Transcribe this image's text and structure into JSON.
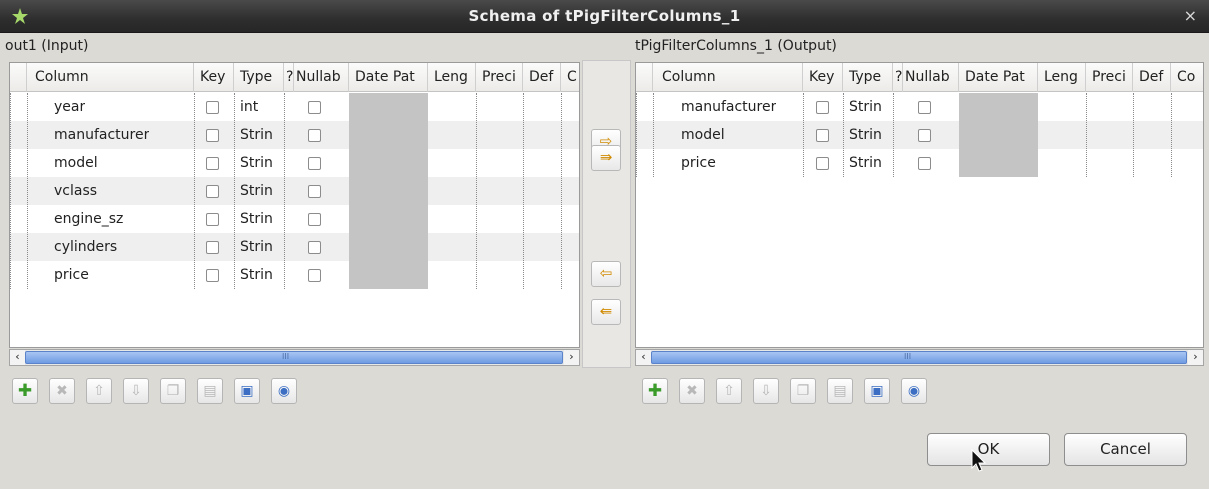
{
  "window": {
    "title": "Schema of tPigFilterColumns_1"
  },
  "left_panel": {
    "title": "out1 (Input)",
    "headers": [
      "Column",
      "Key",
      "Type",
      "?",
      "Nullab",
      "Date Pat",
      "Leng",
      "Preci",
      "Def",
      "C"
    ],
    "rows": [
      {
        "column": "year",
        "type": "int"
      },
      {
        "column": "manufacturer",
        "type": "Strin"
      },
      {
        "column": "model",
        "type": "Strin"
      },
      {
        "column": "vclass",
        "type": "Strin"
      },
      {
        "column": "engine_sz",
        "type": "Strin"
      },
      {
        "column": "cylinders",
        "type": "Strin"
      },
      {
        "column": "price",
        "type": "Strin"
      }
    ],
    "scroll_grip": "III"
  },
  "right_panel": {
    "title": "tPigFilterColumns_1 (Output)",
    "headers": [
      "Column",
      "Key",
      "Type",
      "?",
      "Nullab",
      "Date Pat",
      "Leng",
      "Preci",
      "Def",
      "Co"
    ],
    "rows": [
      {
        "column": "manufacturer",
        "type": "Strin"
      },
      {
        "column": "model",
        "type": "Strin"
      },
      {
        "column": "price",
        "type": "Strin"
      }
    ],
    "scroll_grip": "III"
  },
  "buttons": {
    "ok": "OK",
    "cancel": "Cancel"
  },
  "colors": {
    "accent_green": "#3a9a2a",
    "arrow_orange": "#d08a00",
    "folder_blue": "#3c6fc4"
  }
}
